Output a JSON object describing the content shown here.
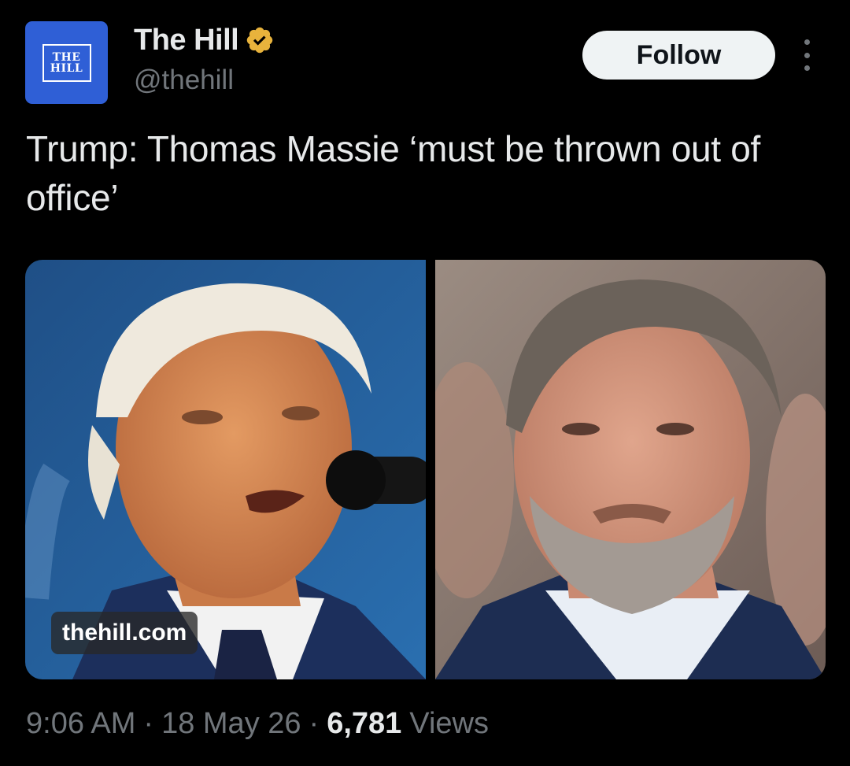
{
  "author": {
    "avatar_logo_line1": "THE",
    "avatar_logo_line2": "HILL",
    "display_name": "The Hill",
    "handle": "@thehill",
    "verified_badge_color": "#e8b33c"
  },
  "actions": {
    "follow_label": "Follow",
    "more_icon": "more-vertical-icon"
  },
  "tweet": {
    "text": "Trump: Thomas Massie ‘must be thrown out of office’"
  },
  "media": {
    "link_badge": "thehill.com"
  },
  "meta": {
    "time": "9:06 AM",
    "separator": "·",
    "date": "18 May 26",
    "views_count": "6,781",
    "views_label": "Views"
  },
  "colors": {
    "background": "#000000",
    "primary_text": "#e7e9ea",
    "secondary_text": "#71767b",
    "avatar_blue": "#2f5fd6",
    "follow_button_bg": "#eff3f4"
  }
}
